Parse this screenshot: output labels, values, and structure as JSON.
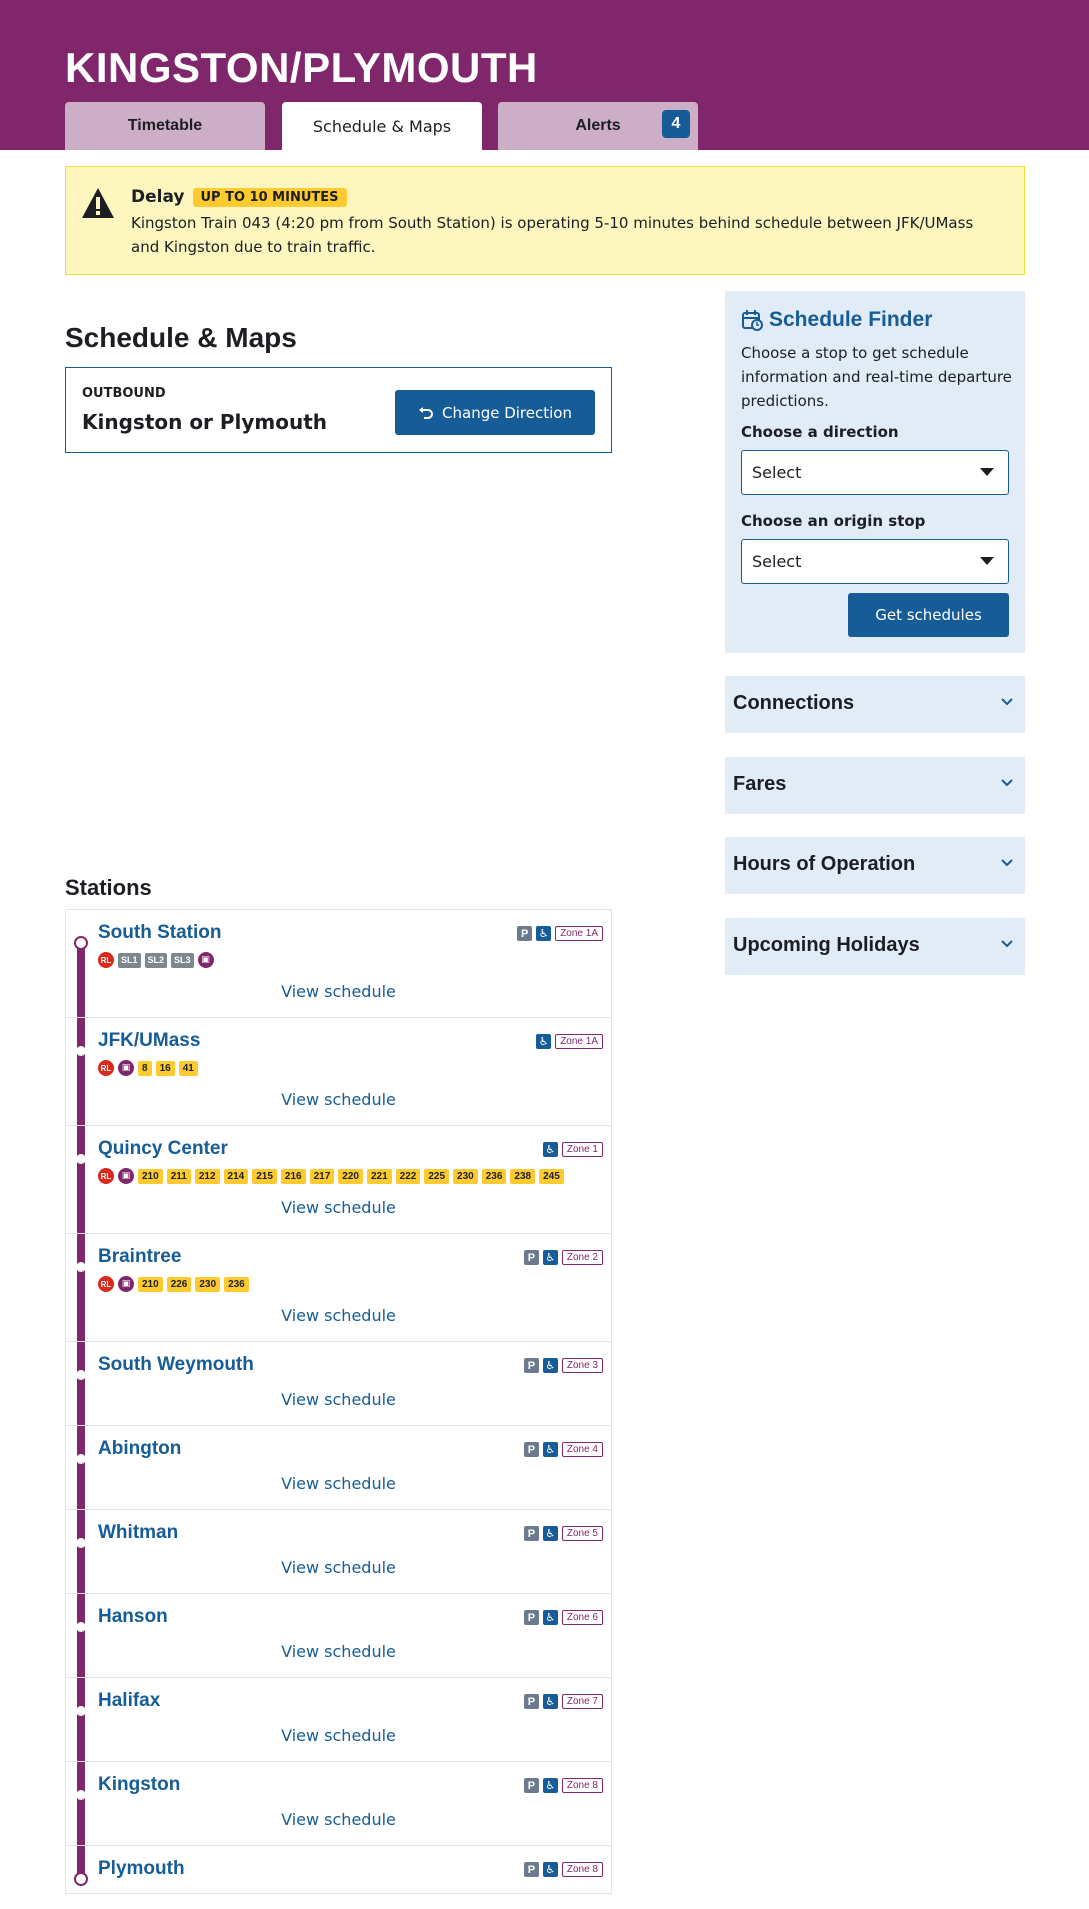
{
  "header": {
    "title": "KINGSTON/PLYMOUTH",
    "tabs": [
      {
        "label": "Timetable",
        "active": false
      },
      {
        "label": "Schedule & Maps",
        "active": true
      },
      {
        "label": "Alerts",
        "active": false,
        "badge": "4"
      }
    ],
    "brand_color": "#80276c"
  },
  "alert": {
    "title": "Delay",
    "badge": "UP TO 10 MINUTES",
    "text": "Kingston Train 043 (4:20 pm from South Station) is operating 5-10 minutes behind schedule between JFK/UMass and Kingston due to train traffic.",
    "icon": "warning-icon"
  },
  "main": {
    "title": "Schedule & Maps",
    "direction": {
      "label": "OUTBOUND",
      "value": "Kingston or Plymouth",
      "button_label": "Change Direction"
    },
    "stations_title": "Stations",
    "view_schedule_label": "View schedule",
    "stations": [
      {
        "name": "South Station",
        "parking": true,
        "accessible": true,
        "zone": "Zone 1A",
        "connections": [
          {
            "type": "rl",
            "label": "RL"
          },
          {
            "type": "sl",
            "label": "SL1"
          },
          {
            "type": "sl",
            "label": "SL2"
          },
          {
            "type": "sl",
            "label": "SL3"
          },
          {
            "type": "cr",
            "label": ""
          }
        ]
      },
      {
        "name": "JFK/UMass",
        "parking": false,
        "accessible": true,
        "zone": "Zone 1A",
        "connections": [
          {
            "type": "rl",
            "label": "RL"
          },
          {
            "type": "cr",
            "label": ""
          },
          {
            "type": "bus",
            "label": "8"
          },
          {
            "type": "bus",
            "label": "16"
          },
          {
            "type": "bus",
            "label": "41"
          }
        ]
      },
      {
        "name": "Quincy Center",
        "parking": false,
        "accessible": true,
        "zone": "Zone 1",
        "connections": [
          {
            "type": "rl",
            "label": "RL"
          },
          {
            "type": "cr",
            "label": ""
          },
          {
            "type": "bus",
            "label": "210"
          },
          {
            "type": "bus",
            "label": "211"
          },
          {
            "type": "bus",
            "label": "212"
          },
          {
            "type": "bus",
            "label": "214"
          },
          {
            "type": "bus",
            "label": "215"
          },
          {
            "type": "bus",
            "label": "216"
          },
          {
            "type": "bus",
            "label": "217"
          },
          {
            "type": "bus",
            "label": "220"
          },
          {
            "type": "bus",
            "label": "221"
          },
          {
            "type": "bus",
            "label": "222"
          },
          {
            "type": "bus",
            "label": "225"
          },
          {
            "type": "bus",
            "label": "230"
          },
          {
            "type": "bus",
            "label": "236"
          },
          {
            "type": "bus",
            "label": "238"
          },
          {
            "type": "bus",
            "label": "245"
          }
        ]
      },
      {
        "name": "Braintree",
        "parking": true,
        "accessible": true,
        "zone": "Zone 2",
        "connections": [
          {
            "type": "rl",
            "label": "RL"
          },
          {
            "type": "cr",
            "label": ""
          },
          {
            "type": "bus",
            "label": "210"
          },
          {
            "type": "bus",
            "label": "226"
          },
          {
            "type": "bus",
            "label": "230"
          },
          {
            "type": "bus",
            "label": "236"
          }
        ]
      },
      {
        "name": "South Weymouth",
        "parking": true,
        "accessible": true,
        "zone": "Zone 3",
        "connections": []
      },
      {
        "name": "Abington",
        "parking": true,
        "accessible": true,
        "zone": "Zone 4",
        "connections": []
      },
      {
        "name": "Whitman",
        "parking": true,
        "accessible": true,
        "zone": "Zone 5",
        "connections": []
      },
      {
        "name": "Hanson",
        "parking": true,
        "accessible": true,
        "zone": "Zone 6",
        "connections": []
      },
      {
        "name": "Halifax",
        "parking": true,
        "accessible": true,
        "zone": "Zone 7",
        "connections": []
      },
      {
        "name": "Kingston",
        "parking": true,
        "accessible": true,
        "zone": "Zone 8",
        "connections": []
      },
      {
        "name": "Plymouth",
        "parking": true,
        "accessible": true,
        "zone": "Zone 8",
        "connections": [],
        "no_link": true
      }
    ]
  },
  "sidebar": {
    "finder": {
      "title": "Schedule Finder",
      "description": "Choose a stop to get schedule information and real-time departure predictions.",
      "direction_label": "Choose a direction",
      "direction_value": "Select",
      "origin_label": "Choose an origin stop",
      "origin_value": "Select",
      "button_label": "Get schedules"
    },
    "accordions": [
      {
        "label": "Connections"
      },
      {
        "label": "Fares"
      },
      {
        "label": "Hours of Operation"
      },
      {
        "label": "Upcoming Holidays"
      }
    ]
  },
  "icons": {
    "parking": "P",
    "accessible": "♿"
  }
}
